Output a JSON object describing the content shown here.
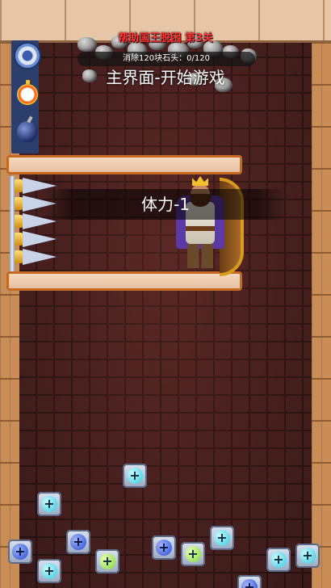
{
  "header": {
    "level_title": "帮助国王脱困 第3关",
    "progress_text": "消除120块石头：0/120",
    "overlay_text": "主界面-开始游戏"
  },
  "toast": {
    "text": "体力-1"
  },
  "tools": [
    {
      "name": "settings",
      "icon": "gear-icon"
    },
    {
      "name": "timer",
      "icon": "stopwatch-icon"
    },
    {
      "name": "bomb",
      "icon": "bomb-icon"
    }
  ],
  "blocks": [
    {
      "color": "cyan",
      "symbol": "+"
    },
    {
      "color": "cyan",
      "symbol": "+"
    },
    {
      "color": "blue",
      "symbol": "+"
    },
    {
      "color": "blue",
      "symbol": "+"
    },
    {
      "color": "cyan",
      "symbol": "+"
    },
    {
      "color": "green",
      "symbol": "+"
    },
    {
      "color": "blue",
      "symbol": "+"
    },
    {
      "color": "green",
      "symbol": "+"
    },
    {
      "color": "cyan",
      "symbol": "+"
    },
    {
      "color": "cyan",
      "symbol": "+"
    },
    {
      "color": "cyan",
      "symbol": "+"
    },
    {
      "color": "blue",
      "symbol": "+"
    }
  ],
  "colors": {
    "level_title": "#ff3b3b",
    "plank_border": "#c46a25",
    "wall": "#4b2322"
  }
}
